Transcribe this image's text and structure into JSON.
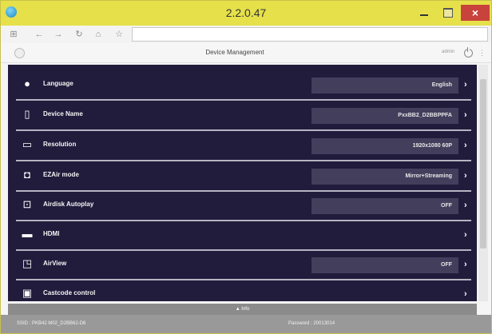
{
  "window": {
    "title": "2.2.0.47",
    "close_symbol": "×"
  },
  "nav": {
    "buttons": [
      "grid-icon",
      "back-icon",
      "forward-icon",
      "refresh-icon",
      "home-icon",
      "bookmark-icon"
    ],
    "address": ""
  },
  "header": {
    "title": "Device Management",
    "user": "admin"
  },
  "rows": [
    {
      "icon": "globe-icon",
      "label": "Language",
      "value": "English"
    },
    {
      "icon": "device-icon",
      "label": "Device Name",
      "value": "PxxBB2_D2BBPPFA"
    },
    {
      "icon": "monitor-icon",
      "label": "Resolution",
      "value": "1920x1080 60P"
    },
    {
      "icon": "ezair-icon",
      "label": "EZAir mode",
      "value": "Mirror+Streaming"
    },
    {
      "icon": "airdisk-icon",
      "label": "Airdisk Autoplay",
      "value": "OFF"
    },
    {
      "icon": "hdmi-icon",
      "label": "HDMI",
      "value": ""
    },
    {
      "icon": "airview-icon",
      "label": "AirView",
      "value": "OFF"
    },
    {
      "icon": "castcode-icon",
      "label": "Castcode control",
      "value": ""
    }
  ],
  "footer": {
    "info_toggle": "▲ Info",
    "ssid": "SSID : PKB42 M02_D2BB62-D6",
    "password": "Password : 20013014"
  },
  "colors": {
    "titlebar": "#e6e04a",
    "content_bg": "#211c3c",
    "value_box": "#433e5c",
    "statusbar": "#999999"
  }
}
